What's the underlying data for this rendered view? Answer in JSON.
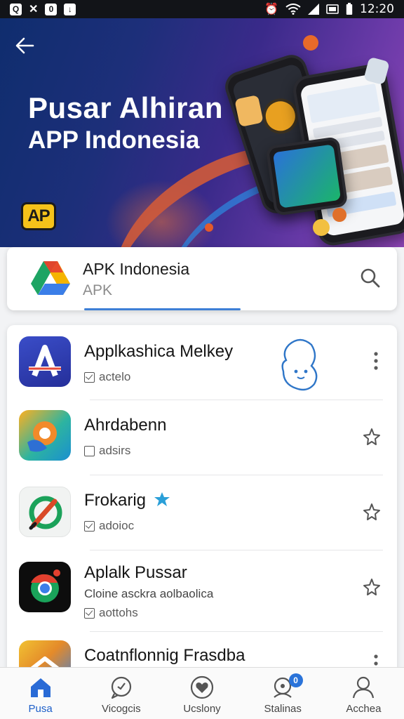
{
  "status_bar": {
    "time": "12:20",
    "left_icons": [
      "q-app-icon",
      "shuffle-icon",
      "shield-icon",
      "download-icon"
    ],
    "right_icons": [
      "alarm-icon",
      "wifi-icon",
      "signal-icon",
      "sim-icon",
      "battery-icon"
    ]
  },
  "hero": {
    "title": "Pusar Alhiran",
    "subtitle": "APP Indonesia",
    "logo_text": "AP"
  },
  "search": {
    "title": "APK Indonesia",
    "subtitle": "APK"
  },
  "apps": [
    {
      "name": "Applkashica Melkey",
      "meta": "actelo",
      "icon": "blue-a-logo",
      "action": "more-icon"
    },
    {
      "name": "Ahrdabenn",
      "meta": "adsirs",
      "icon": "orange-pin-logo",
      "action": "pin-icon"
    },
    {
      "name": "Frokarig",
      "meta": "adoioc",
      "icon": "green-brush-logo",
      "action": "pin-icon"
    },
    {
      "name": "Aplalk Pussar",
      "description": "Cloine asckra aolbaolica",
      "meta": "aottohs",
      "icon": "chrome-style-logo",
      "action": "pin-icon"
    },
    {
      "name": "Coatnflonnig Frasdba",
      "icon": "folder-logo",
      "action": "more-icon"
    }
  ],
  "bottom_nav": [
    {
      "label": "Pusa",
      "icon": "home-icon",
      "active": true
    },
    {
      "label": "Vicogcis",
      "icon": "chat-icon",
      "active": false
    },
    {
      "label": "Ucslony",
      "icon": "heart-icon",
      "active": false
    },
    {
      "label": "Stalinas",
      "icon": "support-icon",
      "active": false,
      "badge": "0"
    },
    {
      "label": "Acchea",
      "icon": "profile-icon",
      "active": false
    }
  ],
  "colors": {
    "accent": "#1d5fc9",
    "hero_start": "#0f2d6e",
    "hero_end": "#9046b8",
    "status_bar": "#121418"
  }
}
